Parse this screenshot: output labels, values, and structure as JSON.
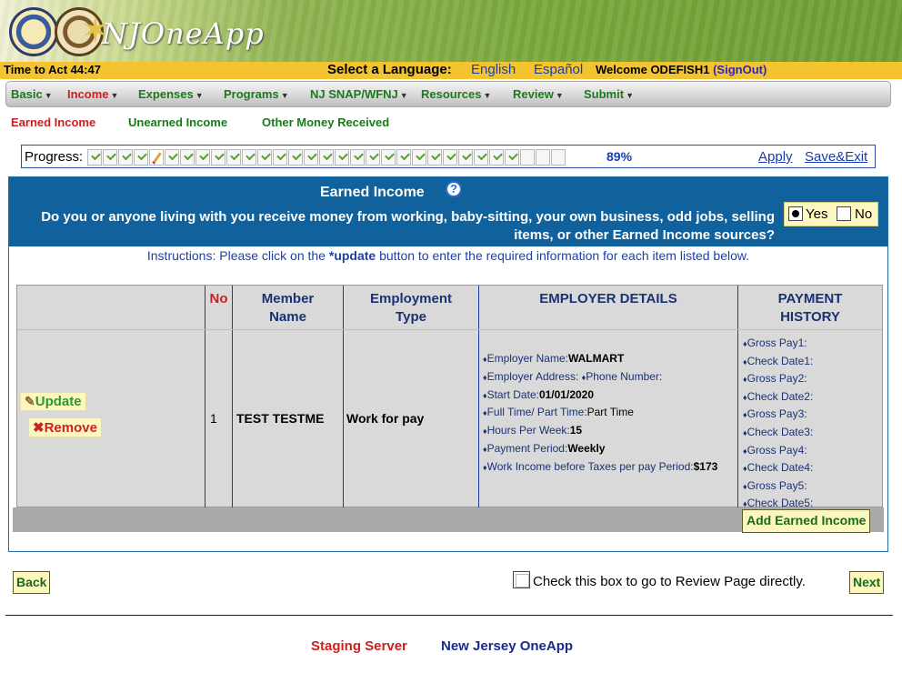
{
  "header": {
    "brand": "NJOneApp"
  },
  "status": {
    "timer": "Time to Act 44:47",
    "language_label": "Select a Language:",
    "lang_english": "English",
    "lang_spanish": "Español",
    "welcome": "Welcome ODEFISH1",
    "signout": "(SignOut)"
  },
  "menu": [
    {
      "label": "Basic"
    },
    {
      "label": "Income"
    },
    {
      "label": "Expenses"
    },
    {
      "label": "Programs"
    },
    {
      "label": "NJ SNAP/WFNJ"
    },
    {
      "label": "Resources"
    },
    {
      "label": "Review"
    },
    {
      "label": "Submit"
    }
  ],
  "subtabs": [
    "Earned Income",
    "Unearned Income",
    "Other Money Received"
  ],
  "progress": {
    "label": "Progress:",
    "percent_text": "89%",
    "fraction": 0.89,
    "apply": "Apply",
    "save_exit": "Save&Exit"
  },
  "section": {
    "title": "Earned Income",
    "question": "Do you or anyone living with you receive money from working, baby-sitting, your own business, odd jobs, selling items, or other Earned Income sources?",
    "yes": "Yes",
    "no": "No",
    "instructions_pre": "Instructions: Please click on the ",
    "instructions_bold": "*update",
    "instructions_post": " button to enter the required information for each item listed below."
  },
  "table": {
    "headers": {
      "no": "No",
      "member": "Member Name",
      "employment": "Employment Type",
      "employer": "EMPLOYER DETAILS",
      "payment": "PAYMENT HISTORY"
    },
    "row": {
      "update": "Update",
      "remove": "Remove",
      "no": "1",
      "member": "TEST TESTME",
      "employment": "Work for pay",
      "employer_details": [
        {
          "label": "Employer Name:",
          "value": "WALMART"
        },
        {
          "label": "Employer Address: ",
          "value": ""
        },
        {
          "label": "Start Date:",
          "value": "01/01/2020"
        },
        {
          "label": "Full Time/ Part Time:",
          "value": "Part Time"
        },
        {
          "label": "Hours Per Week:",
          "value": "15"
        },
        {
          "label": "Payment Period:",
          "value": "Weekly"
        },
        {
          "label": "Work Income before Taxes per pay Period:",
          "value": "$173"
        }
      ],
      "phone_label": "Phone Number:",
      "payment_history": [
        "Gross Pay1:",
        "Check Date1:",
        "Gross Pay2:",
        "Check Date2:",
        "Gross Pay3:",
        "Check Date3:",
        "Gross Pay4:",
        "Check Date4:",
        "Gross Pay5:",
        "Check Date5:"
      ]
    },
    "add_button": "Add Earned Income"
  },
  "bottom": {
    "back": "Back",
    "review_check": "Check this box to go to Review Page directly.",
    "next": "Next"
  },
  "footer": {
    "staging": "Staging Server",
    "app": "New Jersey OneApp"
  },
  "colors": {
    "header_blue": "#11629c",
    "status_yellow": "#f4c430",
    "active_red": "#cc1f1f",
    "menu_green": "#1a7a1a"
  }
}
